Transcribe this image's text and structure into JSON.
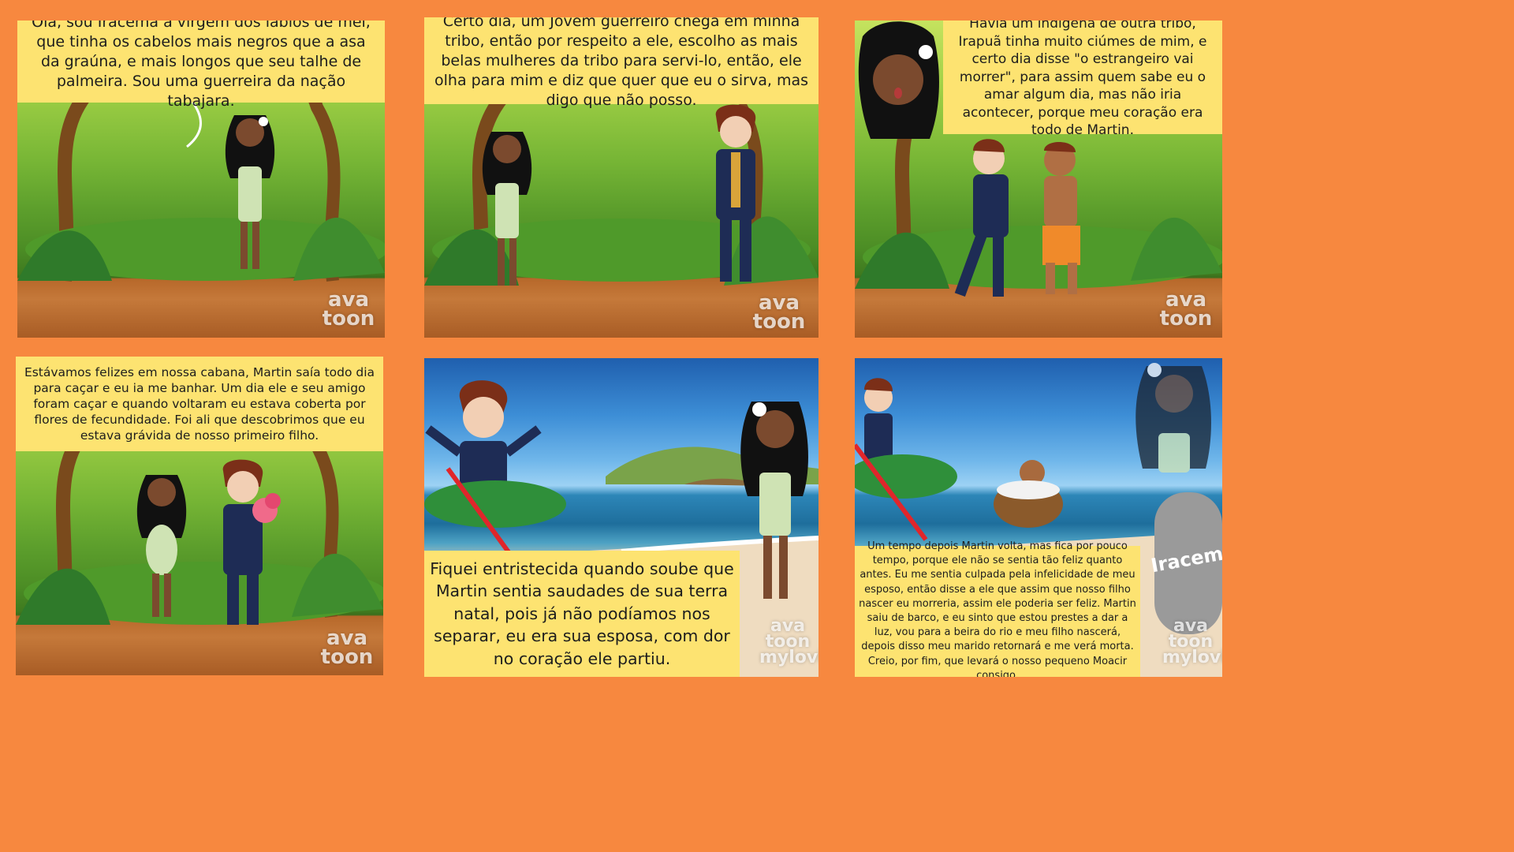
{
  "colors": {
    "background": "#f7883f",
    "caption_bg": "#fde371"
  },
  "panels": [
    {
      "scene": "jungle",
      "caption": "Olá, sou Iracema a virgem dos lábios de mel, que tinha os cabelos mais negros que a asa da graúna, e mais longos que seu talhe de palmeira. Sou uma guerreira da nação tabajara.",
      "watermark": "ava\ntoon"
    },
    {
      "scene": "jungle",
      "caption": "Certo dia, um Jovem guerreiro chega em minha tribo, então por respeito a ele, escolho as mais belas mulheres da tribo para servi-lo, então, ele olha para mim e diz que quer que eu o sirva, mas digo que não posso.",
      "watermark": "ava\ntoon"
    },
    {
      "scene": "jungle",
      "caption": "Havia um indígena de outra tribo, Irapuã tinha muito ciúmes de mim, e certo dia disse \"o estrangeiro vai morrer\", para assim quem sabe eu o amar algum dia, mas não iria acontecer, porque meu coração era todo de Martin.",
      "watermark": "ava\ntoon"
    },
    {
      "scene": "jungle",
      "caption": "Estávamos felizes em nossa cabana, Martin saía todo dia para caçar e eu ia me banhar. Um dia ele e seu amigo foram caçar e quando voltaram eu estava coberta por flores de fecundidade. Foi ali que descobrimos que eu estava grávida de nosso primeiro filho.",
      "watermark": "ava\ntoon"
    },
    {
      "scene": "sea",
      "caption": "Fiquei entristecida quando soube que Martin sentia saudades de sua terra natal, pois já não podíamos nos separar, eu era sua esposa, com dor no coração ele partiu.",
      "watermark": "ava\ntoon\nmylovie"
    },
    {
      "scene": "sea",
      "caption": "Um tempo depois Martin volta, mas fica por pouco tempo, porque ele não se sentia tão feliz quanto antes. Eu me sentia culpada pela infelicidade de meu esposo, então disse a ele que assim que nosso filho nascer eu morreria, assim ele poderia ser feliz. Martin saiu de barco, e eu sinto que estou prestes a dar a luz, vou para a beira do rio e meu filho nascerá, depois disso meu marido retornará e me verá morta. Creio, por fim, que levará o nosso pequeno Moacir consigo.",
      "watermark": "ava\ntoon\nmylovie",
      "tombstone": "Iracema"
    }
  ]
}
